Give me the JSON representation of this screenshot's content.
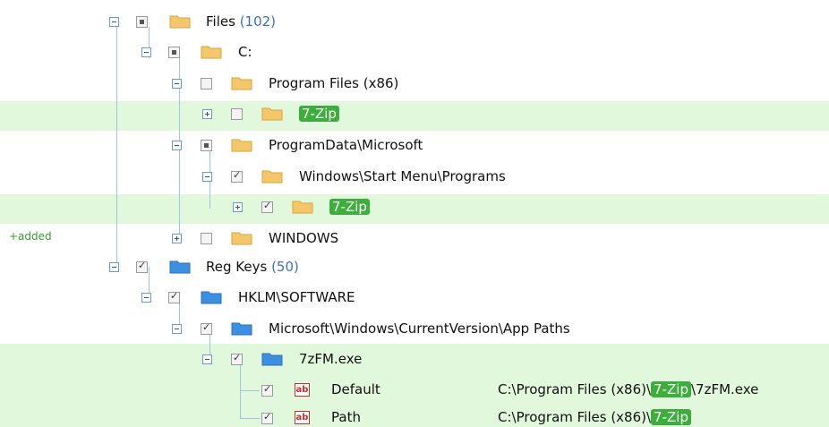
{
  "tree": {
    "files": {
      "label": "Files",
      "count": "(102)"
    },
    "drive_c": {
      "label": "C:"
    },
    "program_files": {
      "label": "Program Files (x86)"
    },
    "zip1": {
      "label": "7-Zip"
    },
    "programdata": {
      "label": "ProgramData\\Microsoft"
    },
    "start_menu": {
      "label": "Windows\\Start Menu\\Programs"
    },
    "zip2": {
      "label": "7-Zip"
    },
    "windows": {
      "label": "WINDOWS"
    },
    "regkeys": {
      "label": "Reg Keys",
      "count": "(50)"
    },
    "hklm": {
      "label": "HKLM\\SOFTWARE"
    },
    "app_paths": {
      "label": "Microsoft\\Windows\\CurrentVersion\\App Paths"
    },
    "sevenzfm": {
      "label": "7zFM.exe"
    },
    "val_default": {
      "name": "Default",
      "icon_text": "ab",
      "data_prefix": "C:\\Program Files (x86)\\",
      "data_tag": "7-Zip",
      "data_suffix": "\\7zFM.exe"
    },
    "val_path": {
      "name": "Path",
      "icon_text": "ab",
      "data_prefix": "C:\\Program Files (x86)\\",
      "data_tag": "7-Zip"
    }
  },
  "status": {
    "added": "+added"
  },
  "colors": {
    "highlight": "#e2f8dc",
    "tag": "#3cae3c",
    "folder": "#f4c86a",
    "reg_folder": "#3d8fe0",
    "tree_lines": "#9ec4e8"
  }
}
